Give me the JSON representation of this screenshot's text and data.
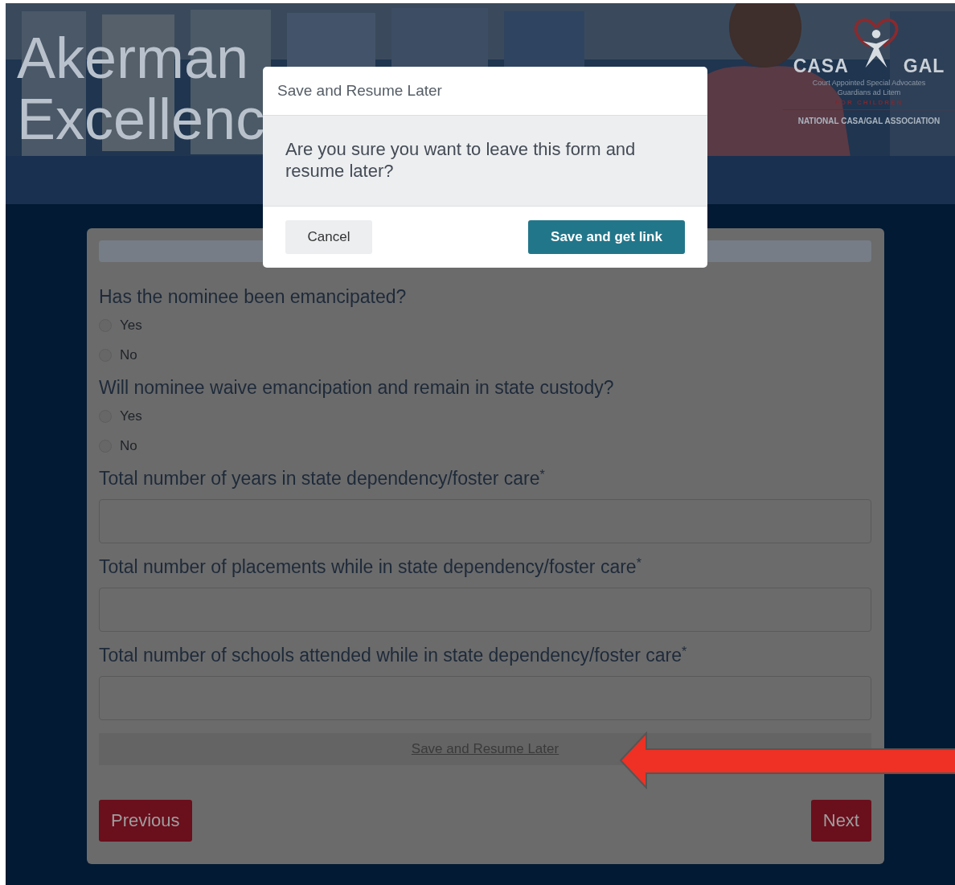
{
  "header": {
    "title_lines": [
      "Akerman",
      "Excellenc"
    ],
    "logo": {
      "left_word": "CASA",
      "right_word": "GAL",
      "subtitle_lines": [
        "Court Appointed Special Advocates",
        "Guardians ad Litem"
      ],
      "tagline": "FOR CHILDREN",
      "association": "NATIONAL CASA/GAL ASSOCIATION"
    }
  },
  "form": {
    "questions": [
      {
        "kind": "radio",
        "label": "Has the nominee been emancipated?",
        "options": [
          {
            "label": "Yes",
            "selected": false
          },
          {
            "label": "No",
            "selected": false
          }
        ]
      },
      {
        "kind": "radio",
        "label": "Will nominee waive emancipation and remain in state custody?",
        "options": [
          {
            "label": "Yes",
            "selected": false
          },
          {
            "label": "No",
            "selected": false
          }
        ]
      },
      {
        "kind": "text",
        "label": "Total number of years in state dependency/foster care",
        "required_mark": "*"
      },
      {
        "kind": "text",
        "label": "Total number of placements while in state dependency/foster care",
        "required_mark": "*"
      },
      {
        "kind": "text",
        "label": "Total number of schools attended while in state dependency/foster care",
        "required_mark": "*"
      }
    ],
    "save_link": "Save and Resume Later",
    "previous": "Previous",
    "next": "Next"
  },
  "dialog": {
    "title": "Save and Resume Later",
    "message": "Are you sure you want to leave this form and resume later?",
    "buttons": [
      {
        "label": "Cancel",
        "kind": "secondary"
      },
      {
        "label": "Save and get link",
        "kind": "primary"
      }
    ]
  },
  "annotation": {
    "kind": "arrow"
  }
}
